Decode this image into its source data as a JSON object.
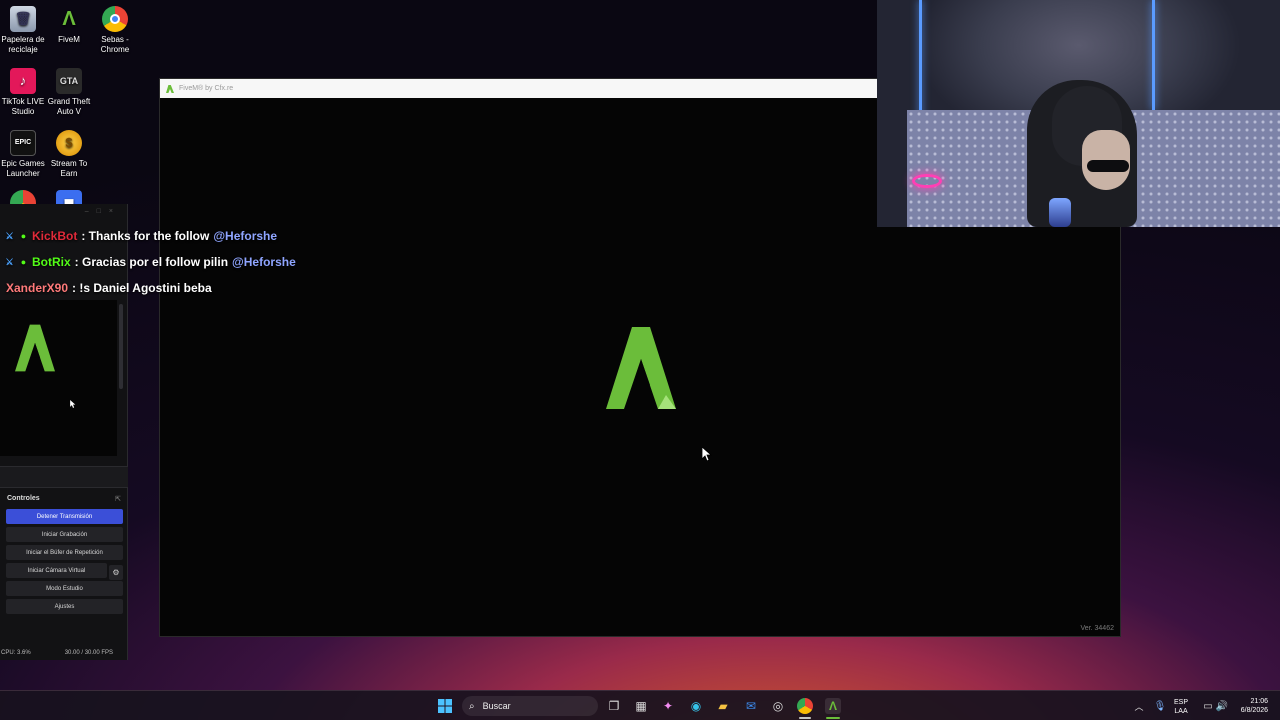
{
  "desktop": {
    "icons": [
      {
        "label": "Papelera de reciclaje",
        "icon": "recycle-bin-icon"
      },
      {
        "label": "FiveM",
        "icon": "fivem-icon"
      },
      {
        "label": "Sebas - Chrome",
        "icon": "chrome-icon"
      },
      {
        "label": "TikTok LIVE Studio",
        "icon": "tiktok-icon"
      },
      {
        "label": "Grand Theft Auto V",
        "icon": "gta-icon"
      },
      {
        "label": "Epic Games Launcher",
        "icon": "epic-games-icon"
      },
      {
        "label": "Stream To Earn",
        "icon": "stream-to-earn-icon"
      }
    ]
  },
  "fivem_window": {
    "title": "FiveM® by Cfx.re",
    "version": "Ver. 34462",
    "accent": "#6bbd3a"
  },
  "chat": {
    "messages": [
      {
        "user": "KickBot",
        "user_color": "#e02a3a",
        "text": ": Thanks for the follow",
        "mention": "@Heforshe",
        "badges": [
          "mod-badge",
          "verified-badge"
        ]
      },
      {
        "user": "BotRix",
        "user_color": "#53fc18",
        "text": ": Gracias por el follow pilin",
        "mention": "@Heforshe",
        "badges": [
          "mod-badge",
          "verified-badge"
        ]
      },
      {
        "user": "XanderX90",
        "user_color": "#ff7a7a",
        "text": ": !s Daniel Agostini beba",
        "mention": "",
        "badges": []
      }
    ]
  },
  "obs": {
    "controls_title": "Controles",
    "buttons": [
      {
        "label": "Detener Transmisión",
        "active": true
      },
      {
        "label": "Iniciar Grabación",
        "active": false
      },
      {
        "label": "Iniciar el Búfer de Repetición",
        "active": false
      },
      {
        "label": "Iniciar Cámara Virtual",
        "active": false
      },
      {
        "label": "Modo Estudio",
        "active": false
      },
      {
        "label": "Ajustes",
        "active": false
      }
    ],
    "cpu": "CPU: 3.6%",
    "fps": "30.00 / 30.00 FPS",
    "accent": "#3b4fd8"
  },
  "taskbar": {
    "search_placeholder": "Buscar",
    "language_line1": "ESP",
    "language_line2": "LAA",
    "time": "21:06",
    "date": "6/8/2026"
  }
}
